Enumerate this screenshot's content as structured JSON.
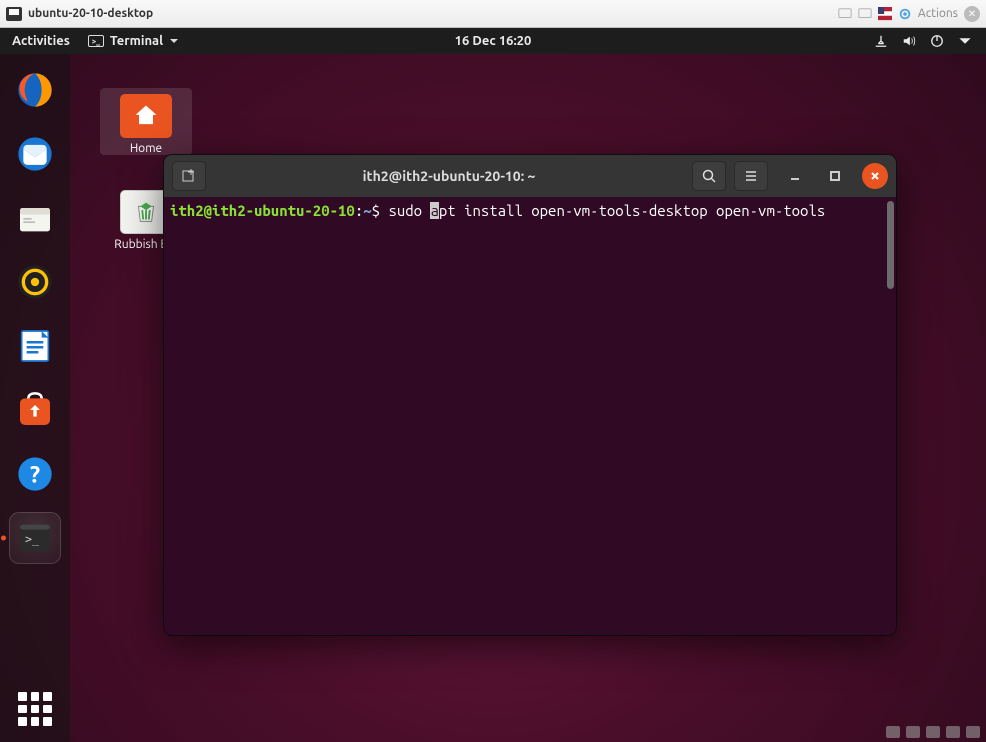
{
  "vm_host": {
    "title": "ubuntu-20-10-desktop",
    "actions_label": "Actions"
  },
  "topbar": {
    "activities": "Activities",
    "app_name": "Terminal",
    "datetime": "16 Dec   16:20"
  },
  "desktop": {
    "home_label": "Home",
    "trash_label": "Rubbish Bin"
  },
  "dock": {
    "items": [
      {
        "name": "firefox"
      },
      {
        "name": "thunderbird"
      },
      {
        "name": "files"
      },
      {
        "name": "rhythmbox"
      },
      {
        "name": "libreoffice-writer"
      },
      {
        "name": "software-center"
      },
      {
        "name": "help"
      },
      {
        "name": "terminal"
      }
    ]
  },
  "terminal": {
    "title": "ith2@ith2-ubuntu-20-10: ~",
    "prompt": {
      "userhost": "ith2@ith2-ubuntu-20-10",
      "sep1": ":",
      "path": "~",
      "sep2": "$ "
    },
    "command_pre": "sudo ",
    "cursor_char": "a",
    "command_post": "pt install open-vm-tools-desktop open-vm-tools"
  }
}
